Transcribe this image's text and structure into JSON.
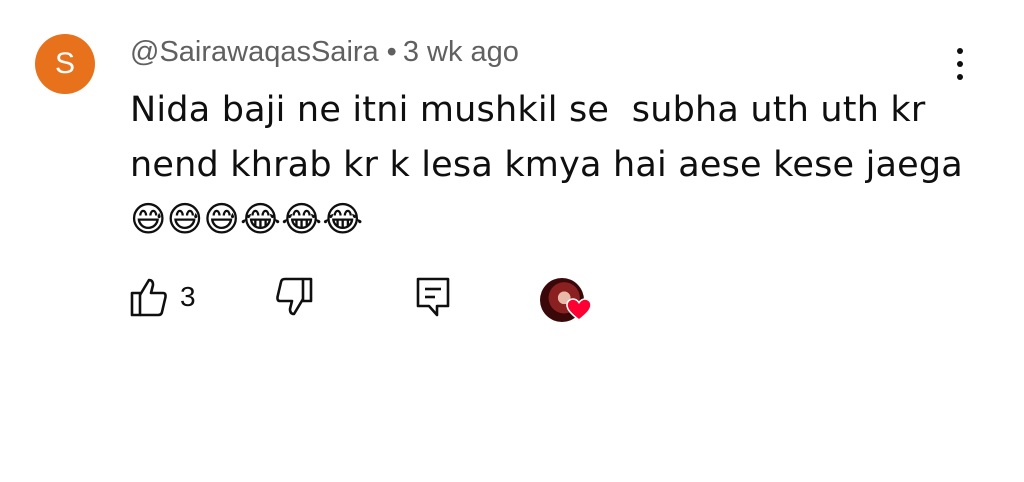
{
  "comment": {
    "avatar_letter": "S",
    "avatar_color": "#e8711c",
    "author": "@SairawaqasSaira",
    "separator": "•",
    "time": "3 wk ago",
    "text": "Nida baji ne itni mushkil se  subha uth uth kr nend khrab kr k lesa kmya hai aese kese jaega 😅😅😅😂😂😂",
    "like_count": "3"
  },
  "icons": {
    "like": "thumbs-up-icon",
    "dislike": "thumbs-down-icon",
    "reply": "reply-comment-icon",
    "more": "more-vertical-icon",
    "creator_heart": "creator-heart-icon"
  },
  "colors": {
    "heart": "#ff0033",
    "meta_text": "#606060"
  }
}
